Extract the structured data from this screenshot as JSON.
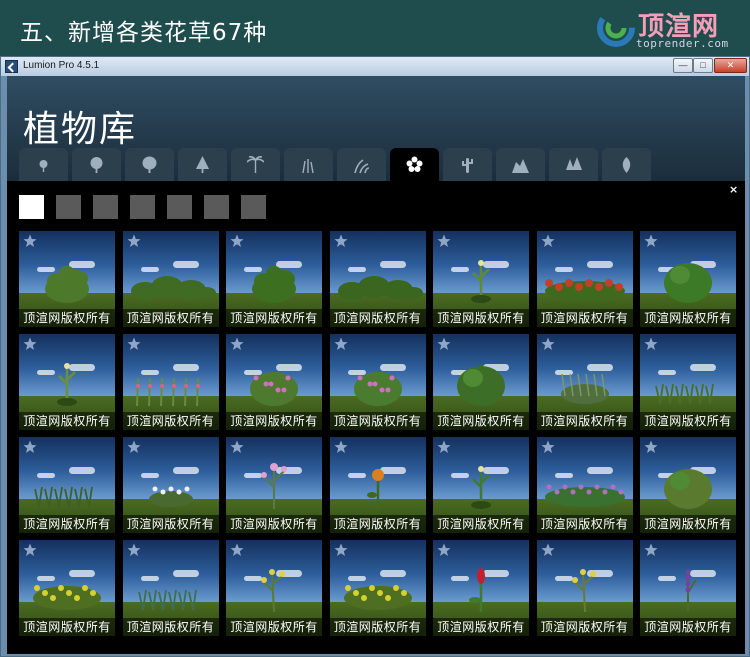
{
  "banner": {
    "title": "五、新增各类花草67种",
    "logo_text": "顶渲网",
    "logo_sub": "toprender.com"
  },
  "window": {
    "title": "Lumion Pro 4.5.1",
    "minimize_glyph": "—",
    "maximize_glyph": "□",
    "close_glyph": "✕"
  },
  "library": {
    "title": "植物库",
    "close_glyph": "×",
    "categories": [
      {
        "icon": "small-tree-icon"
      },
      {
        "icon": "round-tree-icon"
      },
      {
        "icon": "broadleaf-tree-icon"
      },
      {
        "icon": "conifer-tree-icon"
      },
      {
        "icon": "palm-tree-icon"
      },
      {
        "icon": "grass-icon"
      },
      {
        "icon": "plant-leaves-icon"
      },
      {
        "icon": "flower-icon",
        "active": true
      },
      {
        "icon": "cactus-icon"
      },
      {
        "icon": "rock-icon"
      },
      {
        "icon": "forest-icon"
      },
      {
        "icon": "leaf-icon"
      }
    ],
    "pages": [
      {
        "active": true
      },
      {
        "active": false
      },
      {
        "active": false
      },
      {
        "active": false
      },
      {
        "active": false
      },
      {
        "active": false
      },
      {
        "active": false
      }
    ],
    "watermark": "顶渲网版权所有",
    "items": [
      {
        "label": "顶渲网版权所有",
        "plant": "leafy",
        "color": "#4d7a2a"
      },
      {
        "label": "顶渲网版权所有",
        "plant": "bushrow",
        "color": "#3f6b22"
      },
      {
        "label": "顶渲网版权所有",
        "plant": "leafy",
        "color": "#3c7020"
      },
      {
        "label": "顶渲网版权所有",
        "plant": "bushrow",
        "color": "#3a6620"
      },
      {
        "label": "顶渲网版权所有",
        "plant": "stalk",
        "color": "#5e8a36"
      },
      {
        "label": "顶渲网版权所有",
        "plant": "redflowers",
        "color": "#c0402a"
      },
      {
        "label": "顶渲网版权所有",
        "plant": "shrub",
        "color": "#3d7a28"
      },
      {
        "label": "顶渲网版权所有",
        "plant": "stalk",
        "color": "#6b8f3c"
      },
      {
        "label": "顶渲网版权所有",
        "plant": "stalks",
        "color": "#6a8a40"
      },
      {
        "label": "顶渲网版权所有",
        "plant": "pinkbush",
        "color": "#4d7a2e"
      },
      {
        "label": "顶渲网版权所有",
        "plant": "pinkbush",
        "color": "#4a7c30"
      },
      {
        "label": "顶渲网版权所有",
        "plant": "shrub",
        "color": "#3c6e28"
      },
      {
        "label": "顶渲网版权所有",
        "plant": "spiky",
        "color": "#506e40"
      },
      {
        "label": "顶渲网版权所有",
        "plant": "grass",
        "color": "#4a6e2a"
      },
      {
        "label": "顶渲网版权所有",
        "plant": "grass",
        "color": "#3e5f26"
      },
      {
        "label": "顶渲网版权所有",
        "plant": "whiteflowers",
        "color": "#486a30"
      },
      {
        "label": "顶渲网版权所有",
        "plant": "pinkstalk",
        "color": "#5a7a40"
      },
      {
        "label": "顶渲网版权所有",
        "plant": "orangeflower",
        "color": "#d98020"
      },
      {
        "label": "顶渲网版权所有",
        "plant": "stalk",
        "color": "#3f7a30"
      },
      {
        "label": "顶渲网版权所有",
        "plant": "purplerow",
        "color": "#3a7030"
      },
      {
        "label": "顶渲网版权所有",
        "plant": "shrub",
        "color": "#5a7a30"
      },
      {
        "label": "顶渲网版权所有",
        "plant": "yellowbush",
        "color": "#7a8a30"
      },
      {
        "label": "顶渲网版权所有",
        "plant": "grass",
        "color": "#3e6e50"
      },
      {
        "label": "顶渲网版权所有",
        "plant": "yellowstalk",
        "color": "#5a7a30"
      },
      {
        "label": "顶渲网版权所有",
        "plant": "yellowbush",
        "color": "#8a9a20"
      },
      {
        "label": "顶渲网版权所有",
        "plant": "redflower",
        "color": "#c02030"
      },
      {
        "label": "顶渲网版权所有",
        "plant": "yellowstalk",
        "color": "#6a7a30"
      },
      {
        "label": "顶渲网版权所有",
        "plant": "purplestalk",
        "color": "#7a40a0"
      }
    ]
  }
}
